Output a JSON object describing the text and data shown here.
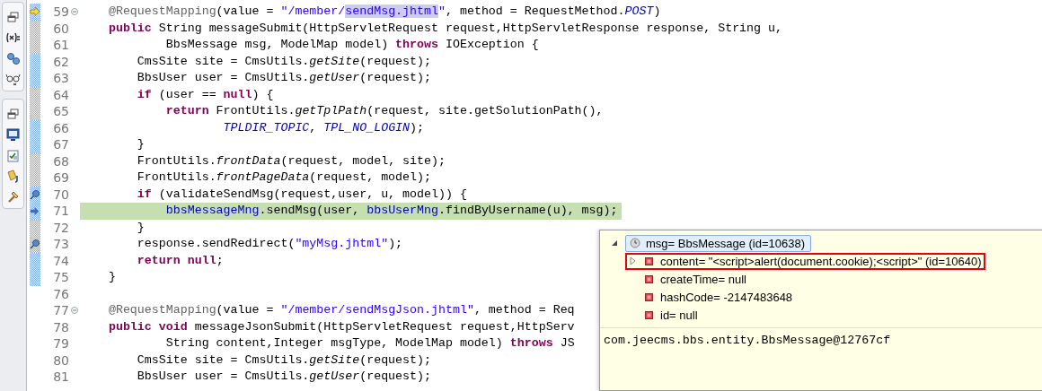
{
  "editor": {
    "lines": [
      {
        "number": "59",
        "fold": true,
        "range": true,
        "marker": {
          "kind": "instruction-pointer"
        },
        "current": false,
        "tokens": [
          {
            "kind": "annotation",
            "text": "    @RequestMapping"
          },
          {
            "kind": "plain",
            "text": "(value = "
          },
          {
            "kind": "string",
            "text": "\"/member/"
          },
          {
            "kind": "selection",
            "text": "sendMsg.jhtml"
          },
          {
            "kind": "string",
            "text": "\""
          },
          {
            "kind": "plain",
            "text": ", method = RequestMethod."
          },
          {
            "kind": "constant",
            "text": "POST"
          },
          {
            "kind": "plain",
            "text": ")"
          }
        ]
      },
      {
        "number": "60",
        "fold": false,
        "range": true,
        "current": false,
        "tokens": [
          {
            "kind": "keyword",
            "text": "    public"
          },
          {
            "kind": "plain",
            "text": " String messageSubmit(HttpServletRequest request,HttpServletResponse response, String u,"
          }
        ]
      },
      {
        "number": "61",
        "fold": false,
        "range": true,
        "current": false,
        "tokens": [
          {
            "kind": "plain",
            "text": "            BbsMessage msg, ModelMap model) "
          },
          {
            "kind": "keyword",
            "text": "throws"
          },
          {
            "kind": "plain",
            "text": " IOException {"
          }
        ]
      },
      {
        "number": "62",
        "fold": false,
        "range": true,
        "current": false,
        "tokens": [
          {
            "kind": "plain",
            "text": "        CmsSite site = CmsUtils."
          },
          {
            "kind": "static-method",
            "text": "getSite"
          },
          {
            "kind": "plain",
            "text": "(request);"
          }
        ]
      },
      {
        "number": "63",
        "fold": false,
        "range": true,
        "current": false,
        "tokens": [
          {
            "kind": "plain",
            "text": "        BbsUser user = CmsUtils."
          },
          {
            "kind": "static-method",
            "text": "getUser"
          },
          {
            "kind": "plain",
            "text": "(request);"
          }
        ]
      },
      {
        "number": "64",
        "fold": false,
        "range": true,
        "current": false,
        "tokens": [
          {
            "kind": "keyword",
            "text": "        if"
          },
          {
            "kind": "plain",
            "text": " (user == "
          },
          {
            "kind": "keyword",
            "text": "null"
          },
          {
            "kind": "plain",
            "text": ") {"
          }
        ]
      },
      {
        "number": "65",
        "fold": false,
        "range": true,
        "current": false,
        "tokens": [
          {
            "kind": "keyword",
            "text": "            return"
          },
          {
            "kind": "plain",
            "text": " FrontUtils."
          },
          {
            "kind": "static-method",
            "text": "getTplPath"
          },
          {
            "kind": "plain",
            "text": "(request, site.getSolutionPath(),"
          }
        ]
      },
      {
        "number": "66",
        "fold": false,
        "range": true,
        "current": false,
        "tokens": [
          {
            "kind": "constant",
            "text": "                    TPLDIR_TOPIC"
          },
          {
            "kind": "plain",
            "text": ", "
          },
          {
            "kind": "constant",
            "text": "TPL_NO_LOGIN"
          },
          {
            "kind": "plain",
            "text": ");"
          }
        ]
      },
      {
        "number": "67",
        "fold": false,
        "range": true,
        "current": false,
        "tokens": [
          {
            "kind": "plain",
            "text": "        }"
          }
        ]
      },
      {
        "number": "68",
        "fold": false,
        "range": true,
        "current": false,
        "tokens": [
          {
            "kind": "plain",
            "text": "        FrontUtils."
          },
          {
            "kind": "static-method",
            "text": "frontData"
          },
          {
            "kind": "plain",
            "text": "(request, model, site);"
          }
        ]
      },
      {
        "number": "69",
        "fold": false,
        "range": true,
        "current": false,
        "tokens": [
          {
            "kind": "plain",
            "text": "        FrontUtils."
          },
          {
            "kind": "static-method",
            "text": "frontPageData"
          },
          {
            "kind": "plain",
            "text": "(request, model);"
          }
        ]
      },
      {
        "number": "70",
        "fold": false,
        "range": true,
        "marker": {
          "kind": "occurrence"
        },
        "current": false,
        "tokens": [
          {
            "kind": "keyword",
            "text": "        if"
          },
          {
            "kind": "plain",
            "text": " (validateSendMsg(request,user, u, model)) {"
          }
        ]
      },
      {
        "number": "71",
        "fold": false,
        "range": true,
        "marker": {
          "kind": "current-instruction"
        },
        "current": true,
        "tokens": [
          {
            "kind": "field",
            "text": "            bbsMessageMng"
          },
          {
            "kind": "plain",
            "text": ".sendMsg(user, "
          },
          {
            "kind": "field",
            "text": "bbsUserMng"
          },
          {
            "kind": "plain",
            "text": ".findByUsername(u), msg);"
          }
        ]
      },
      {
        "number": "72",
        "fold": false,
        "range": true,
        "current": false,
        "tokens": [
          {
            "kind": "plain",
            "text": "        }"
          }
        ]
      },
      {
        "number": "73",
        "fold": false,
        "range": true,
        "marker": {
          "kind": "occurrence"
        },
        "current": false,
        "tokens": [
          {
            "kind": "plain",
            "text": "        response.sendRedirect("
          },
          {
            "kind": "string",
            "text": "\"myMsg.jhtml\""
          },
          {
            "kind": "plain",
            "text": ");"
          }
        ]
      },
      {
        "number": "74",
        "fold": false,
        "range": true,
        "current": false,
        "tokens": [
          {
            "kind": "keyword",
            "text": "        return"
          },
          {
            "kind": "keyword",
            "text": " null"
          },
          {
            "kind": "plain",
            "text": ";"
          }
        ]
      },
      {
        "number": "75",
        "fold": false,
        "range": true,
        "current": false,
        "tokens": [
          {
            "kind": "plain",
            "text": "    }"
          }
        ]
      },
      {
        "number": "76",
        "fold": false,
        "range": false
      },
      {
        "number": "77",
        "fold": true,
        "range": false,
        "current": false,
        "tokens": [
          {
            "kind": "annotation",
            "text": "    @RequestMapping"
          },
          {
            "kind": "plain",
            "text": "(value = "
          },
          {
            "kind": "string",
            "text": "\"/member/sendMsgJson.jhtml\""
          },
          {
            "kind": "plain",
            "text": ", method = Req"
          }
        ]
      },
      {
        "number": "78",
        "fold": false,
        "range": false,
        "current": false,
        "tokens": [
          {
            "kind": "keyword",
            "text": "    public"
          },
          {
            "kind": "keyword",
            "text": " void"
          },
          {
            "kind": "plain",
            "text": " messageJsonSubmit(HttpServletRequest request,HttpServ"
          }
        ]
      },
      {
        "number": "79",
        "fold": false,
        "range": false,
        "current": false,
        "tokens": [
          {
            "kind": "plain",
            "text": "            String content,Integer msgType, ModelMap model) "
          },
          {
            "kind": "keyword",
            "text": "throws"
          },
          {
            "kind": "plain",
            "text": " JS"
          }
        ]
      },
      {
        "number": "80",
        "fold": false,
        "range": false,
        "current": false,
        "tokens": [
          {
            "kind": "plain",
            "text": "        CmsSite site = CmsUtils."
          },
          {
            "kind": "static-method",
            "text": "getSite"
          },
          {
            "kind": "plain",
            "text": "(request);"
          }
        ]
      },
      {
        "number": "81",
        "fold": false,
        "range": false,
        "current": false,
        "tokens": [
          {
            "kind": "plain",
            "text": "        BbsUser user = CmsUtils."
          },
          {
            "kind": "static-method",
            "text": "getUser"
          },
          {
            "kind": "plain",
            "text": "(request);"
          }
        ]
      }
    ]
  },
  "debug_popup": {
    "variable": {
      "text": "msg= BbsMessage  (id=10638)",
      "expanded": true,
      "selected": true
    },
    "fields": [
      {
        "text": "content= \"<script>alert(document.cookie);<script>\" (id=10640)",
        "expandable": true,
        "highlighted": true
      },
      {
        "text": "createTime= null",
        "expandable": false,
        "highlighted": false
      },
      {
        "text": "hashCode= -2147483648",
        "expandable": false,
        "highlighted": false
      },
      {
        "text": "id= null",
        "expandable": false,
        "highlighted": false
      }
    ],
    "details": "com.jeecms.bbs.entity.BbsMessage@12767cf"
  }
}
